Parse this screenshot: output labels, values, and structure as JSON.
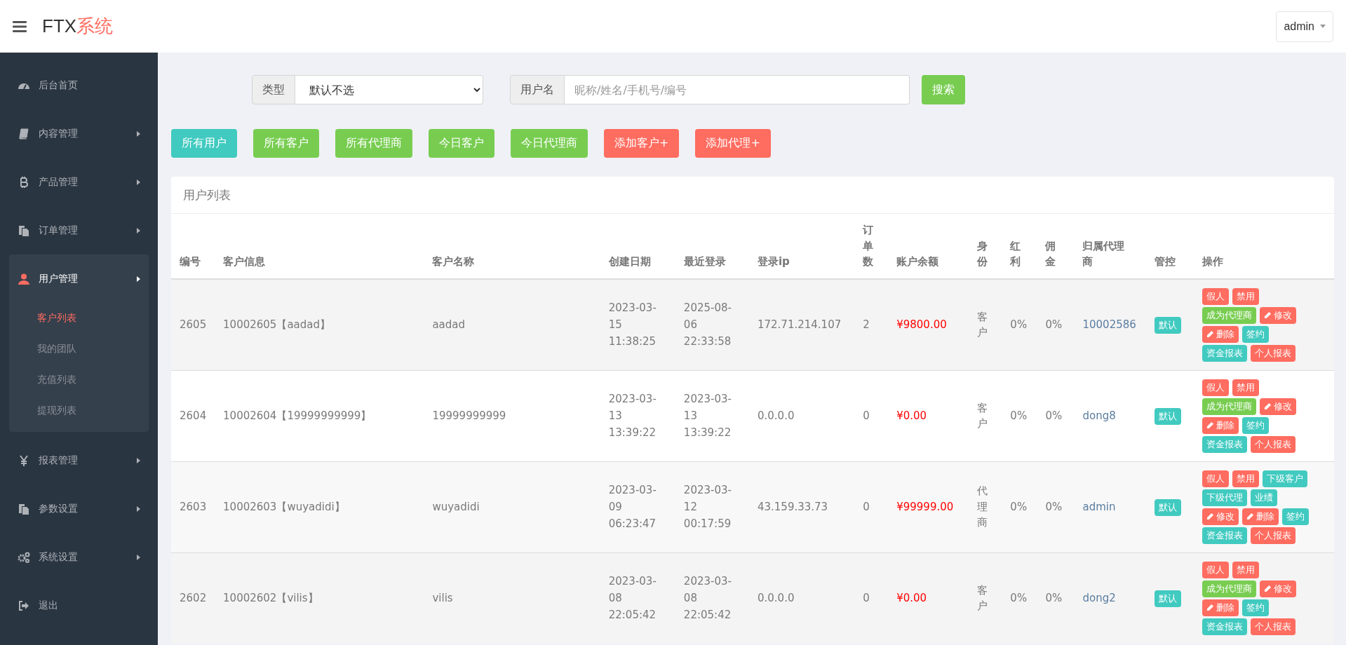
{
  "header": {
    "logo_main": "FTX",
    "logo_accent": "系统",
    "user_menu": "admin"
  },
  "sidebar": {
    "items": [
      {
        "label": "后台首页",
        "has_arrow": false,
        "expanded": false
      },
      {
        "label": "内容管理",
        "has_arrow": true,
        "expanded": false
      },
      {
        "label": "产品管理",
        "has_arrow": true,
        "expanded": false
      },
      {
        "label": "订单管理",
        "has_arrow": true,
        "expanded": false
      },
      {
        "label": "用户管理",
        "has_arrow": true,
        "expanded": true,
        "children": [
          {
            "label": "客户列表",
            "selected": true
          },
          {
            "label": "我的团队",
            "selected": false
          },
          {
            "label": "充值列表",
            "selected": false
          },
          {
            "label": "提现列表",
            "selected": false
          }
        ]
      },
      {
        "label": "报表管理",
        "has_arrow": true,
        "expanded": false
      },
      {
        "label": "参数设置",
        "has_arrow": true,
        "expanded": false
      },
      {
        "label": "系统设置",
        "has_arrow": true,
        "expanded": false
      },
      {
        "label": "退出",
        "has_arrow": false,
        "expanded": false
      }
    ]
  },
  "filters": {
    "type_label": "类型",
    "type_value": "默认不选",
    "username_label": "用户名",
    "username_placeholder": "昵称/姓名/手机号/编号",
    "search_button": "搜索"
  },
  "quick_buttons": [
    {
      "label": "所有用户",
      "kind": "info"
    },
    {
      "label": "所有客户",
      "kind": "success"
    },
    {
      "label": "所有代理商",
      "kind": "success"
    },
    {
      "label": "今日客户",
      "kind": "success"
    },
    {
      "label": "今日代理商",
      "kind": "success"
    },
    {
      "label": "添加客户+",
      "kind": "danger"
    },
    {
      "label": "添加代理+",
      "kind": "danger"
    }
  ],
  "table": {
    "title": "用户列表",
    "columns": [
      "编号",
      "客户信息",
      "客户名称",
      "创建日期",
      "最近登录",
      "登录ip",
      "订单数",
      "账户余额",
      "身份",
      "红利",
      "佣金",
      "归属代理商",
      "管控",
      "操作"
    ],
    "rows": [
      {
        "id": "2605",
        "info": "10002605【aadad】",
        "name": "aadad",
        "created": "2023-03-15 11:38:25",
        "last_login": "2025-08-06 22:33:58",
        "ip": "172.71.214.107",
        "orders": "2",
        "balance": "¥9800.00",
        "role": "客户",
        "bonus": "0%",
        "commission": "0%",
        "agent": "10002586",
        "control": "默认",
        "actions": [
          {
            "label": "假人",
            "kind": "danger",
            "pencil": false
          },
          {
            "label": "禁用",
            "kind": "danger",
            "pencil": false
          },
          {
            "label": "成为代理商",
            "kind": "success",
            "pencil": false
          },
          {
            "label": "修改",
            "kind": "danger",
            "pencil": true
          },
          {
            "label": "删除",
            "kind": "danger",
            "pencil": true
          },
          {
            "label": "签约",
            "kind": "info",
            "pencil": false
          },
          {
            "label": "资金报表",
            "kind": "info",
            "pencil": false
          },
          {
            "label": "个人报表",
            "kind": "danger",
            "pencil": false
          }
        ]
      },
      {
        "id": "2604",
        "info": "10002604【19999999999】",
        "name": "19999999999",
        "created": "2023-03-13 13:39:22",
        "last_login": "2023-03-13 13:39:22",
        "ip": "0.0.0.0",
        "orders": "0",
        "balance": "¥0.00",
        "role": "客户",
        "bonus": "0%",
        "commission": "0%",
        "agent": "dong8",
        "control": "默认",
        "actions": [
          {
            "label": "假人",
            "kind": "danger",
            "pencil": false
          },
          {
            "label": "禁用",
            "kind": "danger",
            "pencil": false
          },
          {
            "label": "成为代理商",
            "kind": "success",
            "pencil": false
          },
          {
            "label": "修改",
            "kind": "danger",
            "pencil": true
          },
          {
            "label": "删除",
            "kind": "danger",
            "pencil": true
          },
          {
            "label": "签约",
            "kind": "info",
            "pencil": false
          },
          {
            "label": "资金报表",
            "kind": "info",
            "pencil": false
          },
          {
            "label": "个人报表",
            "kind": "danger",
            "pencil": false
          }
        ]
      },
      {
        "id": "2603",
        "info": "10002603【wuyadidi】",
        "name": "wuyadidi",
        "created": "2023-03-09 06:23:47",
        "last_login": "2023-03-12 00:17:59",
        "ip": "43.159.33.73",
        "orders": "0",
        "balance": "¥99999.00",
        "role": "代理商",
        "bonus": "0%",
        "commission": "0%",
        "agent": "admin",
        "control": "默认",
        "actions": [
          {
            "label": "假人",
            "kind": "danger",
            "pencil": false
          },
          {
            "label": "禁用",
            "kind": "danger",
            "pencil": false
          },
          {
            "label": "下级客户",
            "kind": "info",
            "pencil": false
          },
          {
            "label": "下级代理",
            "kind": "info",
            "pencil": false
          },
          {
            "label": "业绩",
            "kind": "info",
            "pencil": false
          },
          {
            "label": "修改",
            "kind": "danger",
            "pencil": true
          },
          {
            "label": "删除",
            "kind": "danger",
            "pencil": true
          },
          {
            "label": "签约",
            "kind": "info",
            "pencil": false
          },
          {
            "label": "资金报表",
            "kind": "info",
            "pencil": false
          },
          {
            "label": "个人报表",
            "kind": "danger",
            "pencil": false
          }
        ]
      },
      {
        "id": "2602",
        "info": "10002602【vilis】",
        "name": "vilis",
        "created": "2023-03-08 22:05:42",
        "last_login": "2023-03-08 22:05:42",
        "ip": "0.0.0.0",
        "orders": "0",
        "balance": "¥0.00",
        "role": "客户",
        "bonus": "0%",
        "commission": "0%",
        "agent": "dong2",
        "control": "默认",
        "actions": [
          {
            "label": "假人",
            "kind": "danger",
            "pencil": false
          },
          {
            "label": "禁用",
            "kind": "danger",
            "pencil": false
          },
          {
            "label": "成为代理商",
            "kind": "success",
            "pencil": false
          },
          {
            "label": "修改",
            "kind": "danger",
            "pencil": true
          },
          {
            "label": "删除",
            "kind": "danger",
            "pencil": true
          },
          {
            "label": "签约",
            "kind": "info",
            "pencil": false
          },
          {
            "label": "资金报表",
            "kind": "info",
            "pencil": false
          },
          {
            "label": "个人报表",
            "kind": "danger",
            "pencil": false
          }
        ]
      }
    ]
  }
}
